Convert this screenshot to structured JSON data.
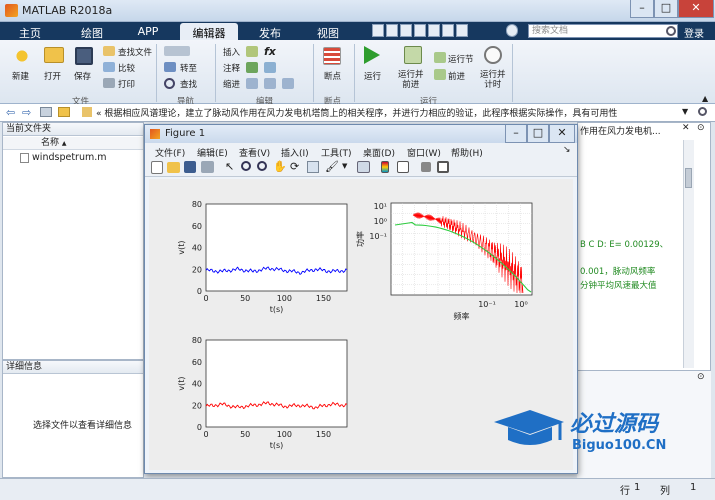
{
  "window": {
    "title": "MATLAB R2018a",
    "minimize": "–",
    "maximize": "□",
    "close": "✕"
  },
  "tabs": [
    "主页",
    "绘图",
    "APP",
    "编辑器",
    "发布",
    "视图"
  ],
  "search": {
    "placeholder": "搜索文档"
  },
  "login": "登录",
  "ribbon": {
    "new": "新建",
    "open": "打开",
    "save": "保存",
    "find_files": "查找文件",
    "compare": "比较",
    "print": "打印",
    "goto": "转至",
    "find": "查找",
    "insert": "插入",
    "comment": "注释",
    "indent": "缩进",
    "fx": "fx",
    "breakpoints": "断点",
    "run": "运行",
    "run_advance": "运行并\n前进",
    "run_section": "运行节",
    "advance": "前进",
    "run_time": "运行并\n计时",
    "group_file": "文件",
    "group_nav": "导航",
    "group_edit": "编辑",
    "group_bp": "断点",
    "group_run": "运行"
  },
  "path": {
    "text": "« 根据相应风谱理论，建立了脉动风作用在风力发电机塔筒上的相关程序，并进行力相应的验证，此程序根据实际操作，具有可用性"
  },
  "current_folder": {
    "title": "当前文件夹",
    "col_name": "名称",
    "sort_arrow": "▲",
    "file": "windspetrum.m"
  },
  "details": {
    "title": "详细信息",
    "message": "选择文件以查看详细信息"
  },
  "editor": {
    "title": "作用在风力发电机...",
    "line1": "B C D: E= 0.00129、",
    "line2": "0.001，脉动风频率",
    "line3": "分钟平均风速最大值"
  },
  "figure": {
    "title": "Figure 1",
    "menu": [
      "文件(F)",
      "编辑(E)",
      "查看(V)",
      "插入(I)",
      "工具(T)",
      "桌面(D)",
      "窗口(W)",
      "帮助(H)"
    ],
    "ax1": {
      "yticks": [
        "80",
        "60",
        "40",
        "20",
        "0"
      ],
      "xticks": [
        "0",
        "50",
        "100",
        "150"
      ],
      "ylabel": "v(t)",
      "xlabel": "t(s)"
    },
    "ax2": {
      "yticks": [
        "10¹",
        "10⁰",
        "10⁻¹"
      ],
      "xticks": [
        "10⁻¹",
        "10⁰"
      ],
      "ylabel": "功率",
      "xlabel": "频率"
    },
    "ax3": {
      "yticks": [
        "80",
        "60",
        "40",
        "20",
        "0"
      ],
      "xticks": [
        "0",
        "50",
        "100",
        "150"
      ],
      "ylabel": "v(t)",
      "xlabel": "t(s)"
    }
  },
  "watermark": {
    "cn": "必过源码",
    "en": "Biguo100.CN"
  },
  "status": {
    "row_label": "行",
    "row": "1",
    "col_label": "列",
    "col": "1"
  },
  "colors": {
    "accent": "#16385f",
    "series_blue": "#0000ff",
    "series_red": "#ff0000",
    "fit_green": "#2ecc40"
  },
  "chart_data": [
    {
      "type": "line",
      "xlabel": "t(s)",
      "ylabel": "v(t)",
      "xlim": [
        0,
        180
      ],
      "ylim": [
        0,
        80
      ],
      "series": [
        {
          "values_note": "",
          "x": [
            0,
            20,
            40,
            60,
            80,
            100,
            120,
            140,
            160,
            180
          ],
          "y": [
            19,
            18,
            20,
            18,
            21,
            19,
            17,
            20,
            18,
            19
          ]
        }
      ]
    },
    {
      "type": "line",
      "xlabel": "频率",
      "ylabel": "功率",
      "log_scale": true
    },
    {
      "type": "line",
      "xlabel": "t(s)",
      "ylabel": "v(t)",
      "xlim": [
        0,
        180
      ],
      "ylim": [
        0,
        80
      ],
      "series": [
        {
          "x": [
            0,
            20,
            40,
            60,
            80,
            100,
            120,
            140,
            160,
            180
          ],
          "y": [
            19,
            21,
            18,
            20,
            22,
            19,
            20,
            18,
            21,
            20
          ]
        }
      ]
    }
  ]
}
